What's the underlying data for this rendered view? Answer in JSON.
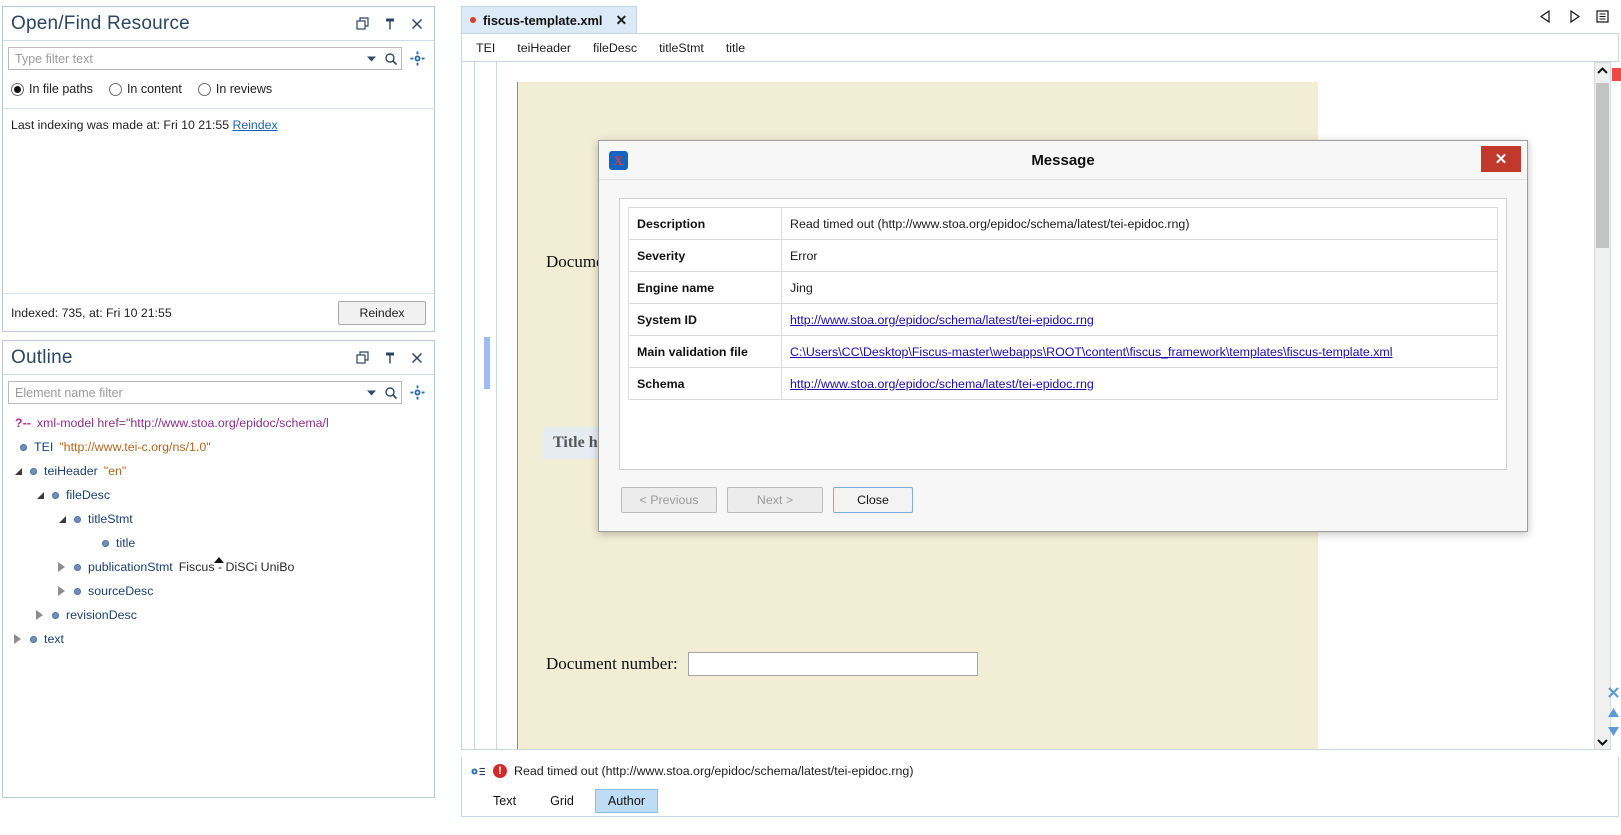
{
  "find_view": {
    "title": "Open/Find Resource",
    "window_icons": [
      "restore-icon",
      "pin-icon",
      "close-icon"
    ],
    "filter": {
      "placeholder": "Type filter text",
      "value": ""
    },
    "scope_options": [
      {
        "label": "In file paths",
        "selected": true
      },
      {
        "label": "In content",
        "selected": false
      },
      {
        "label": "In reviews",
        "selected": false
      }
    ],
    "last_indexing_text": "Last indexing was made at: Fri 10 21:55",
    "reindex_link": "Reindex",
    "footer_status": "Indexed: 735, at: Fri 10 21:55",
    "footer_button": "Reindex"
  },
  "outline_view": {
    "title": "Outline",
    "window_icons": [
      "restore-icon",
      "pin-icon",
      "close-icon"
    ],
    "filter": {
      "placeholder": "Element name filter",
      "value": ""
    },
    "nodes": [
      {
        "kind": "pi",
        "indent": 0,
        "twist": "none",
        "marker": "?--",
        "name": "xml-model href=\"http://www.stoa.org/epidoc/schema/l",
        "attr": "",
        "value": ""
      },
      {
        "kind": "element",
        "indent": 0,
        "twist": "none",
        "marker": "",
        "name": "TEI",
        "attr": "\"http://www.tei-c.org/ns/1.0\"",
        "value": ""
      },
      {
        "kind": "element",
        "indent": 1,
        "twist": "expanded",
        "marker": "",
        "name": "teiHeader",
        "attr": "\"en\"",
        "value": ""
      },
      {
        "kind": "element",
        "indent": 2,
        "twist": "expanded",
        "marker": "",
        "name": "fileDesc",
        "attr": "",
        "value": ""
      },
      {
        "kind": "element",
        "indent": 3,
        "twist": "expanded",
        "marker": "",
        "name": "titleStmt",
        "attr": "",
        "value": ""
      },
      {
        "kind": "element",
        "indent": 4,
        "twist": "none",
        "marker": "",
        "name": "title",
        "attr": "",
        "value": ""
      },
      {
        "kind": "element",
        "indent": 3,
        "twist": "collapsed",
        "marker": "",
        "name": "publicationStmt",
        "attr": "",
        "value": "Fiscus - DiSCi UniBo"
      },
      {
        "kind": "element",
        "indent": 3,
        "twist": "collapsed",
        "marker": "",
        "name": "sourceDesc",
        "attr": "",
        "value": ""
      },
      {
        "kind": "element",
        "indent": 2,
        "twist": "collapsed",
        "marker": "",
        "name": "revisionDesc",
        "attr": "",
        "value": ""
      },
      {
        "kind": "element",
        "indent": 1,
        "twist": "collapsed",
        "marker": "",
        "name": "text",
        "attr": "",
        "value": ""
      }
    ]
  },
  "editor": {
    "tab": {
      "label": "fiscus-template.xml",
      "modified": true,
      "close_label": "✕"
    },
    "tab_nav": [
      "prev-arrow-icon",
      "next-arrow-icon",
      "tab-list-icon"
    ],
    "breadcrumb": [
      "TEI",
      "teiHeader",
      "fileDesc",
      "titleStmt",
      "title"
    ],
    "document": {
      "doc_label_partial": "Documen",
      "title_header_partial": "Title he",
      "document_number_label": "Document number:",
      "document_number_value": ""
    },
    "status_message": "Read timed out (http://www.stoa.org/epidoc/schema/latest/tei-epidoc.rng)",
    "bottom_tabs": [
      {
        "label": "Text",
        "active": false
      },
      {
        "label": "Grid",
        "active": false
      },
      {
        "label": "Author",
        "active": true
      }
    ]
  },
  "modal": {
    "title": "Message",
    "logo_icon": "oxygen-xml-icon",
    "close_icon": "✕",
    "rows": [
      {
        "key": "Description",
        "value": "Read timed out (http://www.stoa.org/epidoc/schema/latest/tei-epidoc.rng)",
        "link": false
      },
      {
        "key": "Severity",
        "value": "Error",
        "link": false
      },
      {
        "key": "Engine name",
        "value": "Jing",
        "link": false
      },
      {
        "key": "System ID",
        "value": "http://www.stoa.org/epidoc/schema/latest/tei-epidoc.rng",
        "link": true
      },
      {
        "key": "Main validation file",
        "value": "C:\\Users\\CC\\Desktop\\Fiscus-master\\webapps\\ROOT\\content\\fiscus_framework\\templates\\fiscus-template.xml",
        "link": true
      },
      {
        "key": "Schema",
        "value": "http://www.stoa.org/epidoc/schema/latest/tei-epidoc.rng",
        "link": true
      }
    ],
    "buttons": {
      "previous": "< Previous",
      "next": "Next >",
      "close": "Close"
    }
  },
  "colors": {
    "accent": "#2b4562",
    "error": "#cf2a28",
    "link": "#1a0dab",
    "page_bg": "#f2eed6",
    "tab_active": "#bfdcf5",
    "modal_close": "#c0392b"
  }
}
